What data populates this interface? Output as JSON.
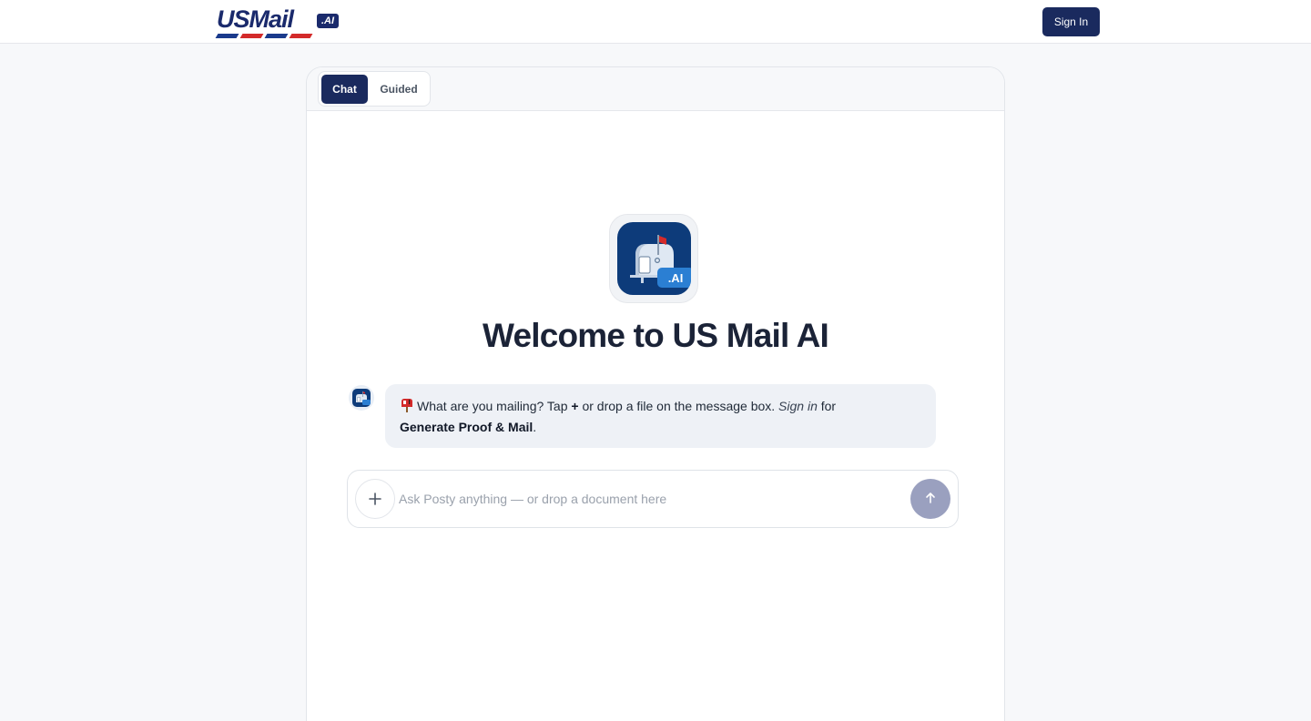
{
  "header": {
    "logo_text": "USMail",
    "logo_badge": ".AI",
    "signin_label": "Sign In"
  },
  "tabs": [
    {
      "label": "Chat",
      "active": true
    },
    {
      "label": "Guided",
      "active": false
    }
  ],
  "hero": {
    "app_icon_badge": ".AI",
    "title": "Welcome to US Mail AI"
  },
  "message": {
    "text_1": "What are you mailing? Tap ",
    "plus": "+",
    "text_2": " or drop a file on the message box. ",
    "signin": "Sign in",
    "text_3": " for",
    "bold": "Generate Proof & Mail",
    "end": "."
  },
  "composer": {
    "placeholder": "Ask Posty anything — or drop a document here",
    "value": ""
  },
  "colors": {
    "brand_navy": "#1a2a5e",
    "icon_blue": "#0d3b7a",
    "send_disabled": "#9aa0bf",
    "stripe_red": "#d32a2a"
  },
  "icons": [
    "mailbox-logo-icon",
    "plus-icon",
    "arrow-up-icon",
    "mailbox-emoji-icon"
  ]
}
